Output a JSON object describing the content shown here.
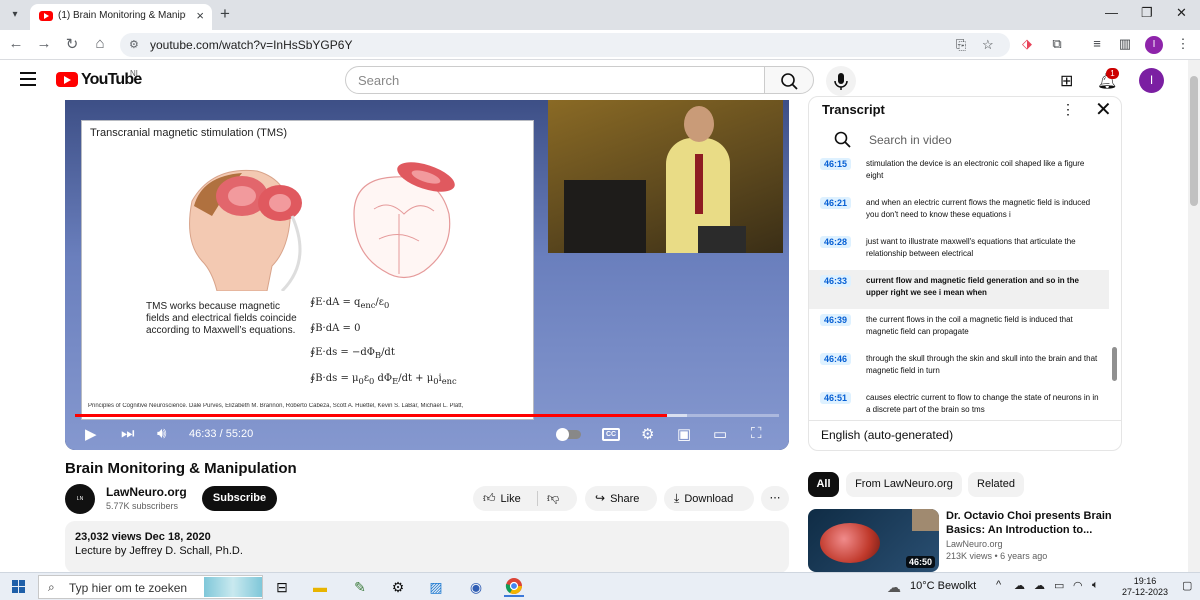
{
  "browser": {
    "tab_title": "(1) Brain Monitoring & Manipul",
    "url": "youtube.com/watch?v=InHsSbYGP6Y",
    "profile_initial": "I"
  },
  "youtube": {
    "logo_text": "YouTube",
    "country": "NL",
    "search_placeholder": "Search",
    "notification_count": "1",
    "avatar_initial": "I"
  },
  "player": {
    "slide_title": "Transcranial magnetic stimulation (TMS)",
    "slide_text": "TMS works because magnetic fields and electrical fields coincide according to Maxwell’s equations.",
    "slide_credit": "Principles of Cognitive Neuroscience. Dale Purves, Elizabeth M. Brannon, Roberto Cabeza, Scott A. Huettel, Kevin S. LaBar, Michael L. Platt,",
    "time_display": "46:33 / 55:20",
    "progress_fraction": 0.8413
  },
  "video": {
    "title": "Brain Monitoring & Manipulation",
    "channel_name": "LawNeuro.org",
    "channel_subs": "5.77K subscribers",
    "subscribe_label": "Subscribe",
    "like_label": "Like",
    "share_label": "Share",
    "download_label": "Download",
    "views_date": "23,032 views  Dec 18, 2020",
    "description": "Lecture by Jeffrey D. Schall, Ph.D."
  },
  "transcript": {
    "title": "Transcript",
    "search_placeholder": "Search in video",
    "language": "English (auto-generated)",
    "rows": [
      {
        "time": "46:15",
        "text": "stimulation the device is an electronic coil shaped like a figure eight"
      },
      {
        "time": "46:21",
        "text": "and when an electric current flows the magnetic field is induced you don't need to know these equations i"
      },
      {
        "time": "46:28",
        "text": "just want to illustrate maxwell's equations that articulate the relationship between electrical"
      },
      {
        "time": "46:33",
        "text": "current flow and magnetic field generation and so in the upper right we see i mean when"
      },
      {
        "time": "46:39",
        "text": "the current flows in the coil a magnetic field is induced that magnetic field can propagate"
      },
      {
        "time": "46:46",
        "text": "through the skull through the skin and skull into the brain and that magnetic field in turn"
      },
      {
        "time": "46:51",
        "text": "causes electric current to flow to change the state of neurons in in a discrete part of the brain so tms"
      }
    ]
  },
  "chips": {
    "all": "All",
    "from_channel": "From LawNeuro.org",
    "related": "Related"
  },
  "related_video": {
    "title": "Dr. Octavio Choi presents Brain Basics: An Introduction to...",
    "channel": "LawNeuro.org",
    "meta": "213K views  •  6 years ago",
    "duration": "46:50"
  },
  "taskbar": {
    "search_placeholder": "Typ hier om te zoeken",
    "weather": "10°C  Bewolkt",
    "time": "19:16",
    "date": "27-12-2023"
  }
}
